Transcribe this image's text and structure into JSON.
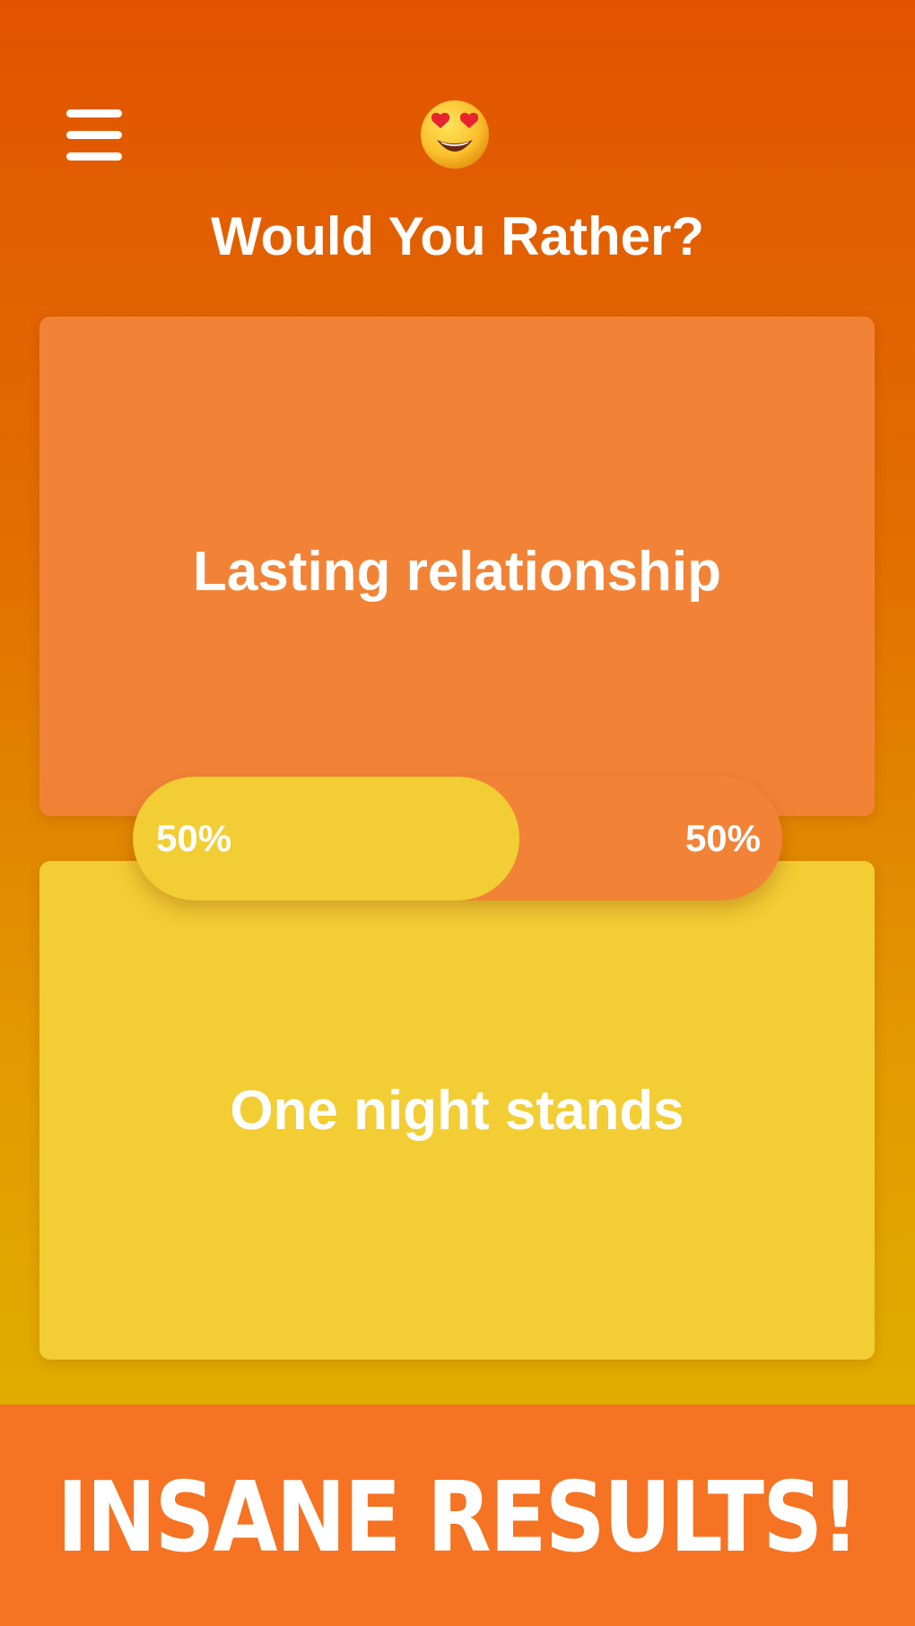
{
  "header": {
    "menu_icon": "hamburger-menu-icon",
    "emoji_icon": "heart-eyes-emoji-icon",
    "title": "Would You Rather?"
  },
  "options": [
    {
      "label": "Lasting relationship",
      "percent_label": "50%",
      "percent": 50,
      "color": "#f28336"
    },
    {
      "label": "One night stands",
      "percent_label": "50%",
      "percent": 50,
      "color": "#f3cd34"
    }
  ],
  "banner": {
    "text": "INSANE RESULTS!",
    "color": "#f57322"
  },
  "colors": {
    "background_top": "#e25300",
    "background_bottom": "#e0b800",
    "text": "#ffffff"
  }
}
